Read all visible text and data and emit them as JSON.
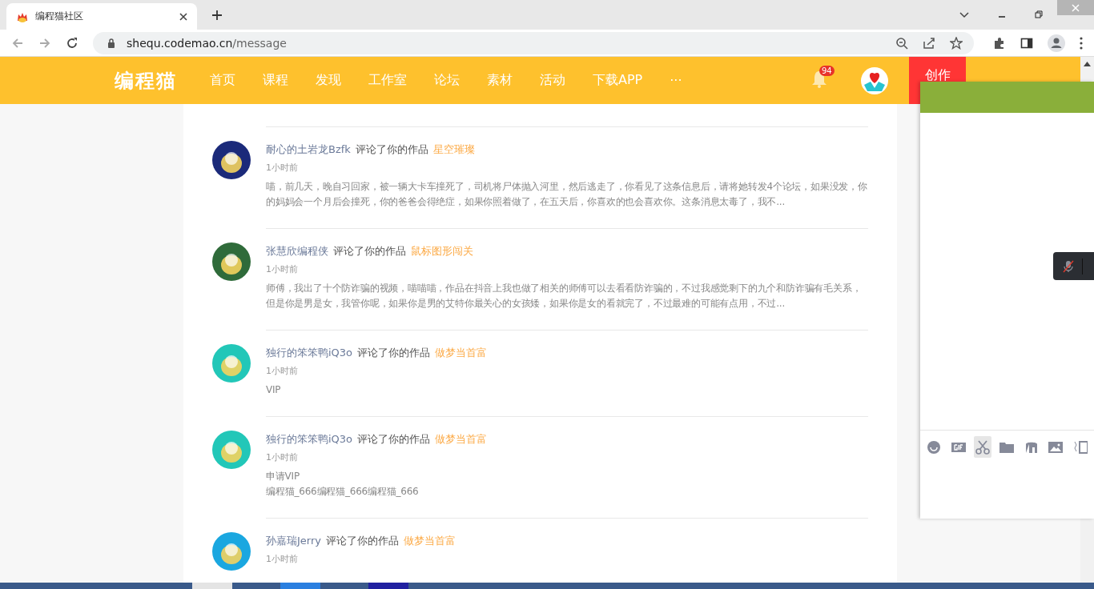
{
  "browser": {
    "tab_title": "编程猫社区",
    "url_host": "shequ.codemao.cn",
    "url_path": "/message"
  },
  "nav": {
    "logo": "编程猫",
    "items": [
      "首页",
      "课程",
      "发现",
      "工作室",
      "论坛",
      "素材",
      "活动",
      "下载APP",
      "···"
    ],
    "notification_count": "94",
    "create_button": "创作"
  },
  "messages": [
    {
      "user": "耐心的土岩龙Bzfk",
      "action": "评论了你的作品",
      "work": "星空璀璨",
      "time": "1小时前",
      "body": [
        "喵，前几天，晚自习回家，被一辆大卡车撞死了，司机将尸体抛入河里，然后逃走了，你看见了这条信息后，请将她转发4个论坛，如果没发，你的妈妈会一个月后会撞死，你的爸爸会得绝症，如果你照着做了，在五天后，你喜欢的也会喜欢你。这条消息太毒了，我不..."
      ]
    },
    {
      "user": "张慧欣编程侠",
      "action": "评论了你的作品",
      "work": "鼠标图形闯关",
      "time": "1小时前",
      "body": [
        "师傅，我出了十个防诈骗的视频，喵喵喵，作品在抖音上我也做了相关的师傅可以去看看防诈骗的，不过我感觉剩下的九个和防诈骗有毛关系，但是你是男是女，我管你呢，如果你是男的艾特你最关心的女孩矮，如果你是女的看就完了，不过最难的可能有点用，不过..."
      ]
    },
    {
      "user": "独行的笨笨鸭iQ3o",
      "action": "评论了你的作品",
      "work": "做梦当首富",
      "time": "1小时前",
      "body": [
        "VIP"
      ]
    },
    {
      "user": "独行的笨笨鸭iQ3o",
      "action": "评论了你的作品",
      "work": "做梦当首富",
      "time": "1小时前",
      "body": [
        "申请VIP",
        "编程猫_666编程猫_666编程猫_666"
      ]
    },
    {
      "user": "孙嘉瑞Jerry",
      "action": "评论了你的作品",
      "work": "做梦当首富",
      "time": "1小时前"
    }
  ]
}
